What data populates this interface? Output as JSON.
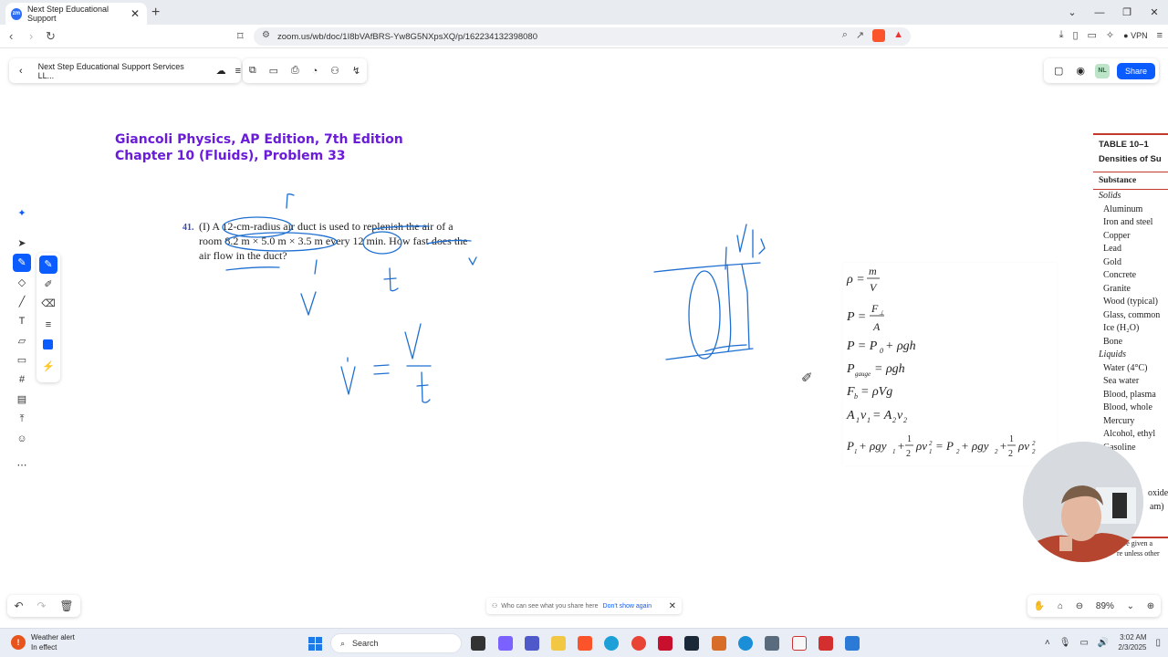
{
  "browser": {
    "tab_title": "Next Step Educational Support",
    "tab_favicon": "zoom",
    "url": "zoom.us/wb/doc/1I8bVAfBRS-Yw8G5NXpsXQ/p/162234132398080",
    "vpn_label": "VPN"
  },
  "whiteboard": {
    "doc_title": "Next Step Educational Support Services LL...",
    "avatar_initials": "NL",
    "share_label": "Share",
    "zoom_level": "89%",
    "notice_text": "Who can see what you share here",
    "notice_link": "Don't show again"
  },
  "content": {
    "heading_line1": "Giancoli Physics, AP Edition, 7th Edition",
    "heading_line2": "Chapter 10 (Fluids), Problem 33",
    "problem_number": "41.",
    "problem_text": "(I) A 12-cm-radius air duct is used to replenish the air of a room 8.2 m × 5.0 m × 3.5 m every 12 min. How fast does the air flow in the duct?"
  },
  "density_table": {
    "title_line1": "TABLE 10–1",
    "title_line2": "Densities of Su",
    "header": "Substance",
    "cat_solids": "Solids",
    "solids": [
      "Aluminum",
      "Iron and steel",
      "Copper",
      "Lead",
      "Gold",
      "Concrete",
      "Granite",
      "Wood (typical)",
      "Glass, common",
      "Ice (H₂O)",
      "Bone"
    ],
    "cat_liquids": "Liquids",
    "liquids": [
      "Water (4°C)",
      "Sea water",
      "Blood, plasma",
      "Blood, whole",
      "Mercury",
      "Alcohol, ethyl",
      "Gasoline"
    ],
    "partial1": "oxide",
    "partial2": "am)",
    "foot1": "are given a",
    "foot2": "re unless other"
  },
  "taskbar": {
    "weather_title": "Weather alert",
    "weather_sub": "In effect",
    "search_label": "Search",
    "time": "3:02 AM",
    "date": "2/3/2025"
  },
  "colors": {
    "accent": "#0b5cff",
    "heading": "#6a1cd8",
    "ink": "#1f6fd1"
  }
}
